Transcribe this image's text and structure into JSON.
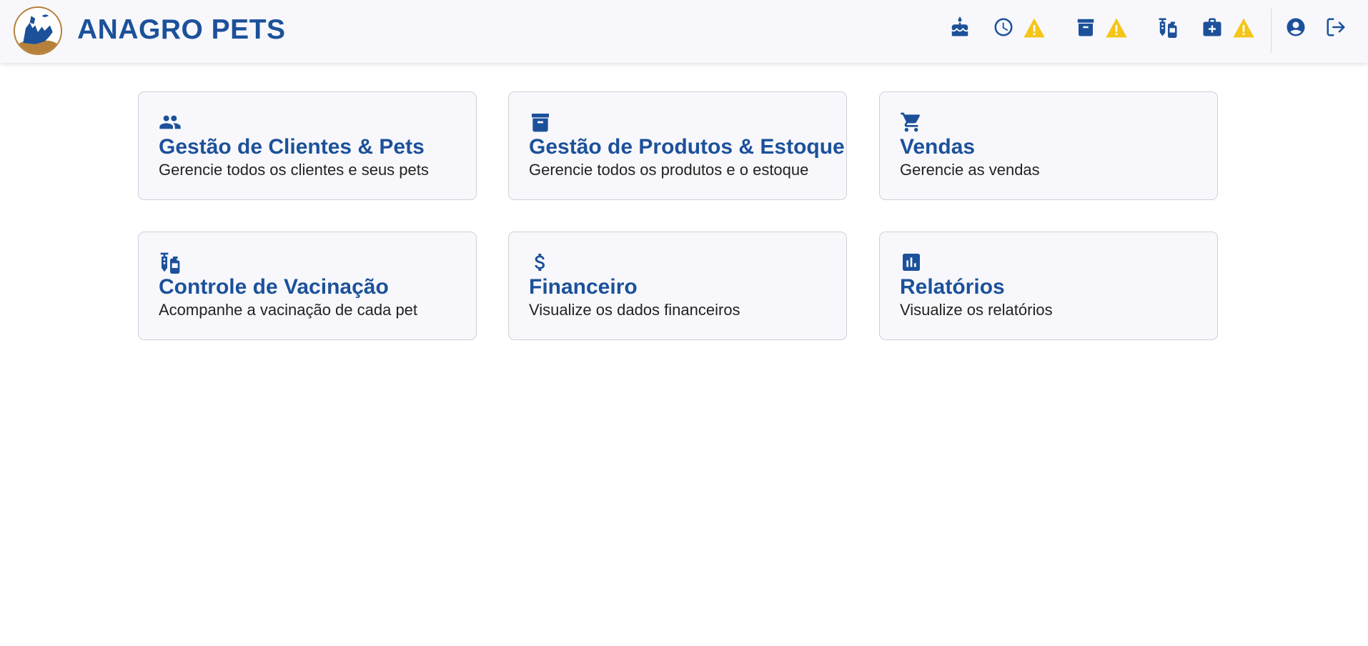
{
  "header": {
    "brand": "ANAGRO PETS",
    "icons": [
      "birthday-cake-icon",
      "clock-icon",
      "archive-box-icon",
      "vaccine-icon",
      "medical-kit-icon",
      "account-circle-icon",
      "logout-icon"
    ],
    "warnings": [
      "clock-warning",
      "stock-warning",
      "medical-warning"
    ]
  },
  "colors": {
    "brand": "#1c519a",
    "warning": "#f5c518",
    "header_bg": "#f8f8fc",
    "card_bg": "#f8f8fc",
    "logo_ring": "#b5813a"
  },
  "cards": [
    {
      "icon": "people-icon",
      "title": "Gestão de Clientes & Pets",
      "description": "Gerencie todos os clientes e seus pets"
    },
    {
      "icon": "archive-box-icon",
      "title": "Gestão de Produtos & Estoque",
      "description": "Gerencie todos os produtos e o estoque"
    },
    {
      "icon": "shopping-cart-icon",
      "title": "Vendas",
      "description": "Gerencie as vendas"
    },
    {
      "icon": "vaccine-icon",
      "title": "Controle de Vacinação",
      "description": "Acompanhe a vacinação de cada pet"
    },
    {
      "icon": "dollar-icon",
      "title": "Financeiro",
      "description": "Visualize os dados financeiros"
    },
    {
      "icon": "bar-chart-icon",
      "title": "Relatórios",
      "description": "Visualize os relatórios"
    }
  ]
}
